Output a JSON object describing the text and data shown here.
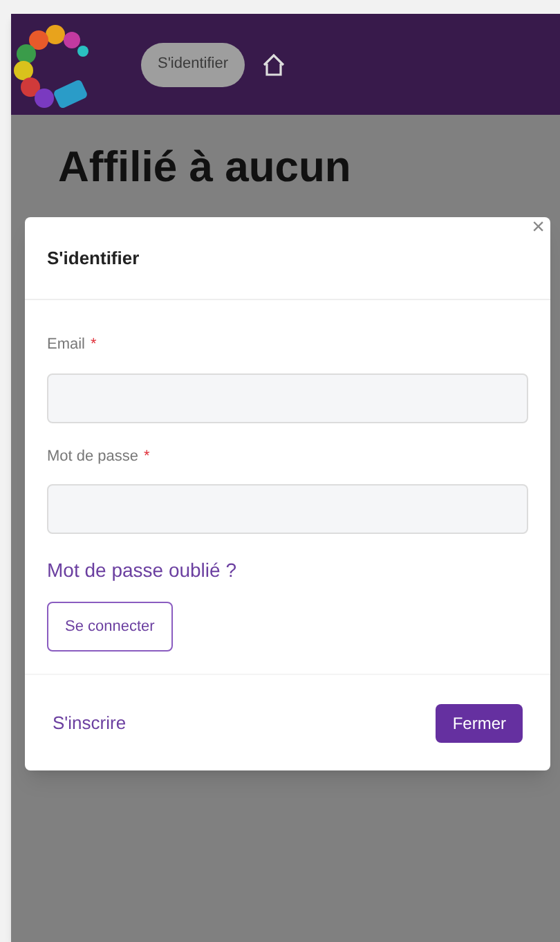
{
  "navbar": {
    "login_button": "S'identifier"
  },
  "page": {
    "heading": "Affilié à aucun"
  },
  "modal": {
    "title": "S'identifier",
    "close": "×",
    "fields": [
      {
        "label": "Email",
        "required_mark": "*"
      },
      {
        "label": "Mot de passe",
        "required_mark": "*"
      }
    ],
    "forgot_link": "Mot de passe oublié ?",
    "submit_button": "Se connecter",
    "register_link": "S'inscrire",
    "close_button": "Fermer"
  }
}
